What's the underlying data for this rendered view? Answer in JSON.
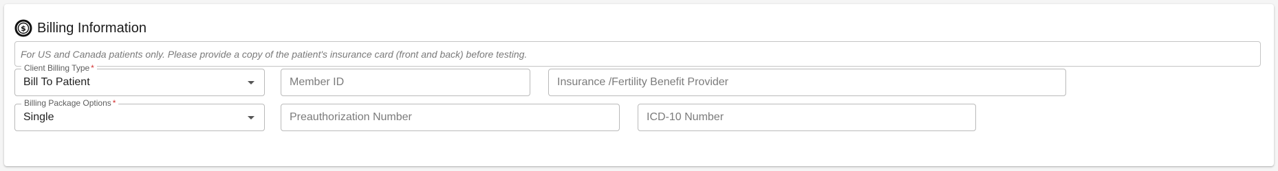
{
  "section": {
    "title": "Billing Information",
    "icon": "dollar-circle-icon",
    "notice": "For US and Canada patients only. Please provide a copy of the patient's insurance card (front and back) before testing."
  },
  "fields": {
    "client_billing_type": {
      "label": "Client Billing Type",
      "required_marker": "*",
      "value": "Bill To Patient"
    },
    "member_id": {
      "placeholder": "Member ID"
    },
    "insurance_provider": {
      "placeholder": "Insurance /Fertility Benefit Provider"
    },
    "billing_package_options": {
      "label": "Billing Package Options",
      "required_marker": "*",
      "value": "Single"
    },
    "preauthorization_number": {
      "placeholder": "Preauthorization Number"
    },
    "icd10_number": {
      "placeholder": "ICD-10 Number"
    }
  },
  "colors": {
    "required": "#d32f2f",
    "border": "#b9b9b9"
  }
}
